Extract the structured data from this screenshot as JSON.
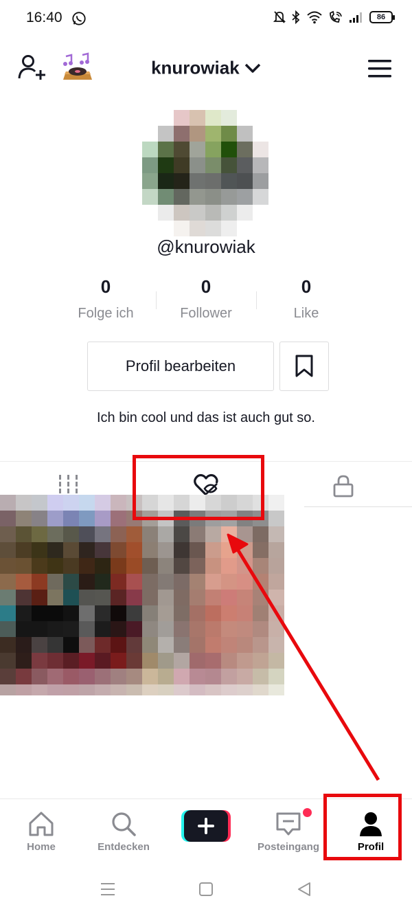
{
  "status_bar": {
    "time": "16:40",
    "battery": "86"
  },
  "header": {
    "username": "knurowiak"
  },
  "profile": {
    "handle": "@knurowiak",
    "bio": "Ich bin cool und das ist auch gut so.",
    "stats": [
      {
        "value": "0",
        "label": "Folge ich"
      },
      {
        "value": "0",
        "label": "Follower"
      },
      {
        "value": "0",
        "label": "Like"
      }
    ],
    "edit_button": "Profil bearbeiten"
  },
  "bottom_nav": {
    "home": "Home",
    "discover": "Entdecken",
    "inbox": "Posteingang",
    "profile": "Profil"
  },
  "colors": {
    "annotation_red": "#e8090d",
    "notification_dot": "#fe2c55",
    "create_cyan": "#25f4ee",
    "create_pink": "#fe2c55"
  },
  "avatar_pixels": [
    [
      "#ffffff",
      "#ffffff",
      "#e6c7c8",
      "#d8c2b0",
      "#dfe8c9",
      "#e3ebdc",
      "#ffffff",
      "#ffffff"
    ],
    [
      "#ffffff",
      "#c4c4c4",
      "#8e6f6e",
      "#b09680",
      "#9fb56e",
      "#6f8b48",
      "#c0c0c0",
      "#ffffff"
    ],
    [
      "#bcd8c0",
      "#5b7248",
      "#4f4a33",
      "#a0a49a",
      "#86a35f",
      "#21500a",
      "#6c6e5f",
      "#ece5e4"
    ],
    [
      "#7d9a83",
      "#1f3a13",
      "#3f3b25",
      "#8b908a",
      "#7a8d6a",
      "#46533a",
      "#5b5d5f",
      "#b7b7b9"
    ],
    [
      "#8aa58c",
      "#1a2716",
      "#242419",
      "#6f7270",
      "#6c6e6c",
      "#505556",
      "#4d5052",
      "#9c9ea0"
    ],
    [
      "#c3d7c5",
      "#718c74",
      "#63675f",
      "#93978f",
      "#8b8f88",
      "#979a98",
      "#9da0a2",
      "#d6d7d8"
    ],
    [
      "#ffffff",
      "#ebebeb",
      "#cdc6c0",
      "#c9c9c7",
      "#b9bab7",
      "#cfd1d0",
      "#ececec",
      "#ffffff"
    ],
    [
      "#ffffff",
      "#ffffff",
      "#f5f2ef",
      "#dfdad6",
      "#dcdcdb",
      "#eeeeee",
      "#ffffff",
      "#ffffff"
    ]
  ],
  "thumb_pixels": [
    [
      "#b9adb1",
      "#c7c5c6",
      "#c4c7cc",
      "#cfcdf0",
      "#cdd3f0",
      "#c6d8ee",
      "#d5cbe4",
      "#cab6bc",
      "#c8c0c0",
      "#d6d6d6",
      "#e6e6e6",
      "#d6d6d6",
      "#ececec",
      "#d7d7d7",
      "#cdcdcd",
      "#d6d6d6",
      "#e0e0e0",
      "#f0f0f0"
    ],
    [
      "#7a6266",
      "#8e8377",
      "#878287",
      "#9d9dc9",
      "#7b84b4",
      "#7f9ac0",
      "#a89bc6",
      "#9c7079",
      "#987a74",
      "#a49e98",
      "#c4c4c4",
      "#5b5b5b",
      "#7b7b7b",
      "#9e9e9e",
      "#a2a2a2",
      "#828282",
      "#8e8e8e",
      "#c8c8c8"
    ],
    [
      "#6e5e4e",
      "#5b5335",
      "#6d6942",
      "#6c6d5d",
      "#58584a",
      "#4f4f59",
      "#76747f",
      "#8c6254",
      "#a05c3a",
      "#8b8178",
      "#aaa8a5",
      "#4b4845",
      "#8b7b75",
      "#b8a9a2",
      "#e8b1a0",
      "#a89590",
      "#7d6b63",
      "#c4b8b3"
    ],
    [
      "#5e4e3a",
      "#4c3d24",
      "#3c3418",
      "#2e291e",
      "#5a4a35",
      "#2f251f",
      "#47363a",
      "#7e4a31",
      "#a14f2c",
      "#8c7f73",
      "#9c9590",
      "#3e3633",
      "#6a5750",
      "#cb9c8c",
      "#e6a38d",
      "#ce9b8c",
      "#856e64",
      "#b7a59d"
    ],
    [
      "#6b5236",
      "#6a5132",
      "#4b3a1b",
      "#3f3415",
      "#4a3a22",
      "#3f2716",
      "#2d2513",
      "#7a3a1b",
      "#9a4b26",
      "#6e5e52",
      "#8c847c",
      "#524742",
      "#7c635b",
      "#c89280",
      "#e19b8a",
      "#d2958a",
      "#a88578",
      "#b8a39b"
    ],
    [
      "#8c6a4c",
      "#a65b3e",
      "#8c3a22",
      "#6f6a5d",
      "#2c4a46",
      "#2a1c16",
      "#21291c",
      "#7c2a22",
      "#a85050",
      "#7c6c64",
      "#837a75",
      "#7c6b66",
      "#a48272",
      "#d79d8e",
      "#d49484",
      "#d78f84",
      "#b48273",
      "#c0a69d"
    ],
    [
      "#6b7c72",
      "#4e3434",
      "#5a1f14",
      "#7c7560",
      "#1e5054",
      "#545450",
      "#565651",
      "#5a2424",
      "#883a4a",
      "#7d6c64",
      "#a19891",
      "#7f6b63",
      "#a57d70",
      "#c28074",
      "#cd7c78",
      "#c68478",
      "#a88277",
      "#cfb4ac"
    ],
    [
      "#2c7c88",
      "#1b1b1b",
      "#0b0b0b",
      "#0b0b0b",
      "#121212",
      "#6e6e6e",
      "#2a2a2a",
      "#100a0a",
      "#3c3c3c",
      "#868078",
      "#a59c94",
      "#7e6d65",
      "#a47065",
      "#bc6e5f",
      "#cc7e70",
      "#c78176",
      "#a08074",
      "#c9ada5"
    ],
    [
      "#4c5c58",
      "#161616",
      "#161616",
      "#1a1a1a",
      "#1c1c1c",
      "#5a5a5a",
      "#1c1c1c",
      "#2a1616",
      "#4a1a26",
      "#8f8881",
      "#a19d99",
      "#8a7470",
      "#a8766a",
      "#bb7a6c",
      "#c48a7c",
      "#c08a7e",
      "#b08a80",
      "#c8b0a8"
    ],
    [
      "#3c2c22",
      "#2a1c1a",
      "#4a4242",
      "#353535",
      "#0e0e0e",
      "#7c5a5a",
      "#6e2a2a",
      "#5c1414",
      "#623a3a",
      "#8f8878",
      "#b4b0ac",
      "#8a7d79",
      "#a47469",
      "#c17c6e",
      "#c08478",
      "#b9887c",
      "#b9968c",
      "#c8b4ac"
    ],
    [
      "#4a3a30",
      "#2e1e1a",
      "#7a3a40",
      "#6e2e34",
      "#5a1e24",
      "#7a1a28",
      "#5a1a22",
      "#7a1c1c",
      "#6a3a36",
      "#a08a6a",
      "#a09a8a",
      "#b2a6a2",
      "#a06a6c",
      "#a86c6e",
      "#b88a80",
      "#c09a8e",
      "#c0a494",
      "#c4b8a4"
    ],
    [
      "#5a3e3a",
      "#783a3e",
      "#8a5a60",
      "#a06a74",
      "#9a5a66",
      "#9a6070",
      "#9c7078",
      "#a08080",
      "#a68a80",
      "#cbb79a",
      "#b8ac90",
      "#d0a8b0",
      "#b88a94",
      "#b48890",
      "#c2a0a0",
      "#c8aaa4",
      "#c6bca8",
      "#d4d4c0"
    ],
    [
      "#b7a2a2",
      "#bfa0a4",
      "#c5a8ac",
      "#c0a0a8",
      "#c0a0a6",
      "#bea4a8",
      "#c4acae",
      "#c8b4b0",
      "#cabcb0",
      "#ddd0c0",
      "#d8d0c0",
      "#dccacc",
      "#d4bcc2",
      "#d8c4c4",
      "#ddcccc",
      "#ddd0cc",
      "#e0d8cc",
      "#e8e8dc"
    ]
  ]
}
